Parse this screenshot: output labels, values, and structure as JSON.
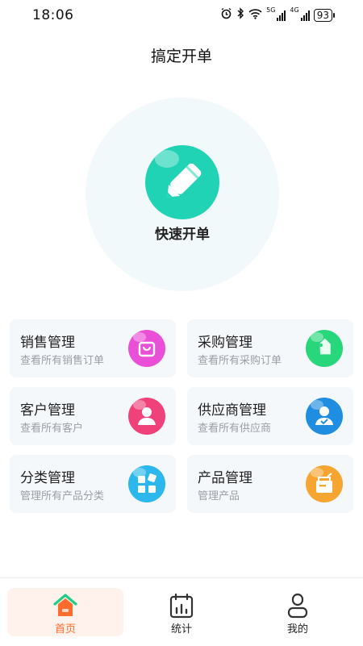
{
  "status_bar": {
    "time": "18:06",
    "net1": "5G",
    "net2": "4G",
    "battery": "93"
  },
  "page": {
    "title": "搞定开单"
  },
  "quick": {
    "label": "快速开单",
    "color": "#1fd3b4"
  },
  "cards": [
    {
      "title": "销售管理",
      "subtitle": "查看所有销售订单",
      "icon": "shopping-bag-icon",
      "color": "#e94fd7"
    },
    {
      "title": "采购管理",
      "subtitle": "查看所有采购订单",
      "icon": "price-tag-icon",
      "color": "#28d77c"
    },
    {
      "title": "客户管理",
      "subtitle": "查看所有客户",
      "icon": "customer-icon",
      "color": "#f0417b"
    },
    {
      "title": "供应商管理",
      "subtitle": "查看所有供应商",
      "icon": "supplier-icon",
      "color": "#1f8de0"
    },
    {
      "title": "分类管理",
      "subtitle": "管理所有产品分类",
      "icon": "category-grid-icon",
      "color": "#2cb8ec"
    },
    {
      "title": "产品管理",
      "subtitle": "管理产品",
      "icon": "product-box-icon",
      "color": "#f6a530"
    }
  ],
  "tabbar": {
    "home": "首页",
    "stats": "统计",
    "mine": "我的",
    "active_color": "#ff6b2c"
  }
}
